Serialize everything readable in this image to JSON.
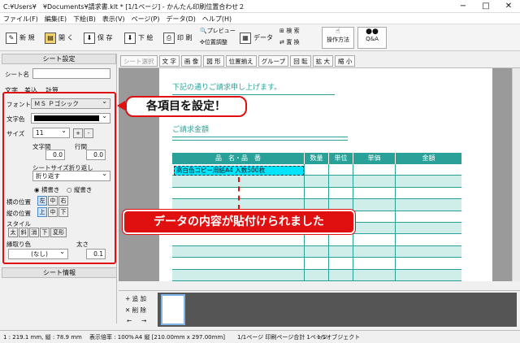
{
  "window": {
    "title": "C:¥Users¥　¥Documents¥請求書.klt * [1/1ページ] - かんたん印刷位置合わせ２",
    "minimize": "−",
    "maximize": "□",
    "close": "✕"
  },
  "menu": [
    "ファイル(F)",
    "編集(E)",
    "下絵(B)",
    "表示(V)",
    "ページ(P)",
    "データ(D)",
    "ヘルプ(H)"
  ],
  "toolbar": {
    "new": "新 規",
    "open": "開 く",
    "save": "保 存",
    "underlay": "下 絵",
    "print": "印 刷",
    "preview": "プレビュー",
    "position": "位置調整",
    "data": "データ",
    "search": "検 索",
    "replace": "置 換",
    "howto": "操作方法",
    "qa": "Q&A"
  },
  "sidebar": {
    "header": "シート設定",
    "sheet_name_label": "シート名",
    "sheet_name_value": "",
    "tabs": [
      "文字",
      "差込",
      "計算"
    ],
    "font_label": "フォント",
    "font_value": "ＭＳ Ｐゴシック",
    "color_label": "文字色",
    "size_label": "サイズ",
    "size_value": "11",
    "plus": "+",
    "minus": "-",
    "char_spacing_label": "文字間",
    "char_spacing_value": "0.0",
    "line_spacing_label": "行間",
    "line_spacing_value": "0.0",
    "wrap_label": "シートサイズ折り返し",
    "wrap_value": "折り返す",
    "horizontal": "横書き",
    "vertical": "縦書き",
    "hpos_label": "横の位置",
    "hpos": [
      "左",
      "中",
      "右"
    ],
    "vpos_label": "縦の位置",
    "vpos": [
      "上",
      "中",
      "下"
    ],
    "style_label": "スタイル",
    "styles": [
      "太",
      "斜",
      "消",
      "下",
      "変形"
    ],
    "outline_label": "縁取り色",
    "outline_value": "(なし)",
    "thickness_label": "太さ",
    "thickness_value": "0.1",
    "info_header": "シート情報"
  },
  "subtoolbar": [
    "シート選択",
    "文 字",
    "画 像",
    "図 形",
    "位置揃え",
    "グループ",
    "回 転",
    "拡 大",
    "縮 小"
  ],
  "document": {
    "intro": "下記の通りご請求申し上げます。",
    "amount_label": "ご請求金額",
    "headers": [
      "品　名・品　番",
      "数量",
      "単位",
      "単価",
      "金額"
    ],
    "row1": "高白色コピー用紙A4 入数500枚"
  },
  "thumbs": {
    "add": "+ 追 加",
    "delete": "✕ 削 除",
    "prev": "←",
    "next": "→"
  },
  "status": {
    "pos": "1 : 219.1 mm, 縦 : 78.9 mm",
    "zoom": "表示倍率 : 100%",
    "paper": "A4 縦 [210.00mm x 297.00mm]",
    "pages": "1/1ページ 印刷ページ合計 1ページ",
    "objects": "1/1オブジェクト"
  },
  "callouts": {
    "top": "各項目を設定！",
    "bottom": "データの内容が貼付けられました"
  },
  "colors": {
    "accent": "#2aa198",
    "red": "#e01010"
  }
}
